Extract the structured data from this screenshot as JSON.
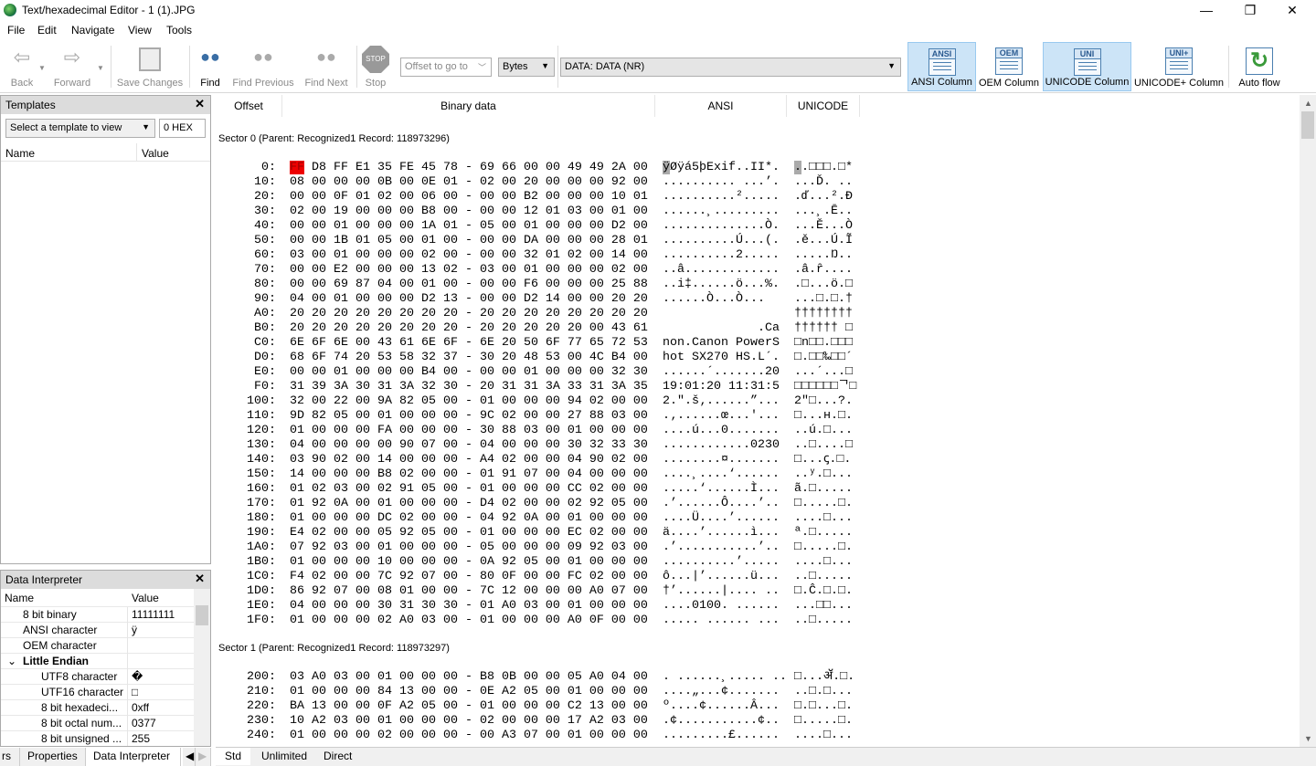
{
  "window": {
    "title": "Text/hexadecimal Editor - 1 (1).JPG",
    "minimize": "—",
    "restore": "❐",
    "close": "✕"
  },
  "menu": [
    "File",
    "Edit",
    "Navigate",
    "View",
    "Tools"
  ],
  "toolbar": {
    "back": "Back",
    "forward": "Forward",
    "save": "Save Changes",
    "find": "Find",
    "find_previous": "Find Previous",
    "find_next": "Find Next",
    "stop": "Stop",
    "stop_sign": "STOP",
    "offset_placeholder": "Offset to go to",
    "unit": "Bytes",
    "data_source": "DATA: DATA (NR)",
    "ansi_column": "ANSI Column",
    "oem_column": "OEM Column",
    "unicode_column": "UNICODE Column",
    "unicode_plus_column": "UNICODE+ Column",
    "auto_flow": "Auto flow",
    "ansi_tag": "ANSI",
    "oem_tag": "OEM",
    "uni_tag": "UNI",
    "uniplus_tag": "UNI+"
  },
  "templates": {
    "title": "Templates",
    "select": "Select a template to view",
    "offset": "0 HEX",
    "col_name": "Name",
    "col_value": "Value"
  },
  "interpreter": {
    "title": "Data Interpreter",
    "col_name": "Name",
    "col_value": "Value",
    "rows": [
      {
        "name": "8 bit binary",
        "value": "11111111",
        "indent": 1
      },
      {
        "name": "ANSI character",
        "value": "ÿ",
        "indent": 1
      },
      {
        "name": "OEM character",
        "value": "",
        "indent": 1
      },
      {
        "name": "Little Endian",
        "value": "",
        "indent": 0,
        "group": true
      },
      {
        "name": "UTF8 character",
        "value": "�",
        "indent": 2
      },
      {
        "name": "UTF16 character",
        "value": "□",
        "indent": 2
      },
      {
        "name": "8 bit hexadeci...",
        "value": "0xff",
        "indent": 2
      },
      {
        "name": "8 bit octal num...",
        "value": "0377",
        "indent": 2
      },
      {
        "name": "8 bit unsigned ...",
        "value": "255",
        "indent": 2
      }
    ]
  },
  "panel_tabs": [
    "rs",
    "Properties",
    "Data Interpreter"
  ],
  "columns": {
    "offset": "Offset",
    "binary": "Binary data",
    "ansi": "ANSI",
    "unicode": "UNICODE"
  },
  "sectors": [
    {
      "label": "Sector 0 (Parent: Recognized1 Record: 118973296)",
      "rows": [
        [
          "0:",
          "FF D8 FF E1 35 FE 45 78 - 69 66 00 00 49 49 2A 00",
          "ÿØÿá5þExif..II*.",
          "..□□□.□*"
        ],
        [
          "10:",
          "08 00 00 00 0B 00 0E 01 - 02 00 20 00 00 00 92 00",
          ".......... ...’.",
          "...Ď. .."
        ],
        [
          "20:",
          "00 00 0F 01 02 00 06 00 - 00 00 B2 00 00 00 10 01",
          "..........².....",
          ".ď...².Đ"
        ],
        [
          "30:",
          "02 00 19 00 00 00 B8 00 - 00 00 12 01 03 00 01 00",
          "......¸.........",
          "...¸.Ē.."
        ],
        [
          "40:",
          "00 00 01 00 00 00 1A 01 - 05 00 01 00 00 00 D2 00",
          "..............Ò.",
          "...Ě...Ò"
        ],
        [
          "50:",
          "00 00 1B 01 05 00 01 00 - 00 00 DA 00 00 00 28 01",
          "..........Ú...(.",
          ".ě...Ú.Ĩ"
        ],
        [
          "60:",
          "03 00 01 00 00 00 02 00 - 00 00 32 01 02 00 14 00",
          "..........2.....",
          ".....Ŋ.."
        ],
        [
          "70:",
          "00 00 E2 00 00 00 13 02 - 03 00 01 00 00 00 02 00",
          "..â.............",
          ".â.ȓ...."
        ],
        [
          "80:",
          "00 00 69 87 04 00 01 00 - 00 00 F6 00 00 00 25 88",
          "..i‡......ö...%.",
          ".□...ö.□"
        ],
        [
          "90:",
          "04 00 01 00 00 00 D2 13 - 00 00 D2 14 00 00 20 20",
          "......Ò...Ò...  ",
          "...□.□.†"
        ],
        [
          "A0:",
          "20 20 20 20 20 20 20 20 - 20 20 20 20 20 20 20 20",
          "                ",
          "††††††††"
        ],
        [
          "B0:",
          "20 20 20 20 20 20 20 20 - 20 20 20 20 20 00 43 61",
          "             .Ca",
          "†††††† □"
        ],
        [
          "C0:",
          "6E 6F 6E 00 43 61 6E 6F - 6E 20 50 6F 77 65 72 53",
          "non.Canon PowerS",
          "□n□□.□□□"
        ],
        [
          "D0:",
          "68 6F 74 20 53 58 32 37 - 30 20 48 53 00 4C B4 00",
          "hot SX270 HS.L´.",
          "□.□□‰□□´"
        ],
        [
          "E0:",
          "00 00 01 00 00 00 B4 00 - 00 00 01 00 00 00 32 30",
          "......´.......20",
          "...´...□"
        ],
        [
          "F0:",
          "31 39 3A 30 31 3A 32 30 - 20 31 31 3A 33 31 3A 35",
          "19:01:20 11:31:5",
          "□□□□□□ᄀ□"
        ],
        [
          "100:",
          "32 00 22 00 9A 82 05 00 - 01 00 00 00 94 02 00 00",
          "2.\".š‚......”...",
          "2\"□...?."
        ],
        [
          "110:",
          "9D 82 05 00 01 00 00 00 - 9C 02 00 00 27 88 03 00",
          ".‚......œ...'...",
          "□...ʜ.□."
        ],
        [
          "120:",
          "01 00 00 00 FA 00 00 00 - 30 88 03 00 01 00 00 00",
          "....ú...0.......",
          "..ú.□..."
        ],
        [
          "130:",
          "04 00 00 00 00 90 07 00 - 04 00 00 00 30 32 33 30",
          "............0230",
          "..□....□"
        ],
        [
          "140:",
          "03 90 02 00 14 00 00 00 - A4 02 00 00 04 90 02 00",
          "........¤.......",
          "□...ꞔ.□."
        ],
        [
          "150:",
          "14 00 00 00 B8 02 00 00 - 01 91 07 00 04 00 00 00",
          "....¸....‘......",
          "..ʸ.□..."
        ],
        [
          "160:",
          "01 02 03 00 02 91 05 00 - 01 00 00 00 CC 02 00 00",
          ".....‘......Ì...",
          "ã.□....."
        ],
        [
          "170:",
          "01 92 0A 00 01 00 00 00 - D4 02 00 00 02 92 05 00",
          ".’......Ô....’..",
          "□.....□."
        ],
        [
          "180:",
          "01 00 00 00 DC 02 00 00 - 04 92 0A 00 01 00 00 00",
          "....Ü....’......",
          "....□..."
        ],
        [
          "190:",
          "E4 02 00 00 05 92 05 00 - 01 00 00 00 EC 02 00 00",
          "ä....’......ì...",
          "ª.□....."
        ],
        [
          "1A0:",
          "07 92 03 00 01 00 00 00 - 05 00 00 00 09 92 03 00",
          ".’...........’..",
          "□.....□."
        ],
        [
          "1B0:",
          "01 00 00 00 10 00 00 00 - 0A 92 05 00 01 00 00 00",
          "..........’.....",
          "....□..."
        ],
        [
          "1C0:",
          "F4 02 00 00 7C 92 07 00 - 80 0F 00 00 FC 02 00 00",
          "ô...|’......ü...",
          "..□....."
        ],
        [
          "1D0:",
          "86 92 07 00 08 01 00 00 - 7C 12 00 00 00 A0 07 00",
          "†’......|.... ..",
          "□.Ĉ.□.□."
        ],
        [
          "1E0:",
          "04 00 00 00 30 31 30 30 - 01 A0 03 00 01 00 00 00",
          "....0100. ......",
          "...□□..."
        ],
        [
          "1F0:",
          "01 00 00 00 02 A0 03 00 - 01 00 00 00 A0 0F 00 00",
          "..... ...... ...",
          "..□....."
        ]
      ]
    },
    {
      "label": "Sector 1 (Parent: Recognized1 Record: 118973297)",
      "rows": [
        [
          "200:",
          "03 A0 03 00 01 00 00 00 - B8 0B 00 00 05 A0 04 00",
          ". ......¸..... ..",
          "□...ॲ.□."
        ],
        [
          "210:",
          "01 00 00 00 84 13 00 00 - 0E A2 05 00 01 00 00 00",
          "....„...¢.......",
          "..□.□..."
        ],
        [
          "220:",
          "BA 13 00 00 0F A2 05 00 - 01 00 00 00 C2 13 00 00",
          "º....¢......Â...",
          "□.□...□."
        ],
        [
          "230:",
          "10 A2 03 00 01 00 00 00 - 02 00 00 00 17 A2 03 00",
          ".¢...........¢..",
          "□.....□."
        ],
        [
          "240:",
          "01 00 00 00 02 00 00 00 - 00 A3 07 00 01 00 00 00",
          ".........£......",
          "....□..."
        ]
      ]
    }
  ],
  "view_tabs": [
    "Std",
    "Unlimited",
    "Direct"
  ],
  "colors": {
    "selection": "#e00000",
    "active_button": "#cce4f7"
  }
}
